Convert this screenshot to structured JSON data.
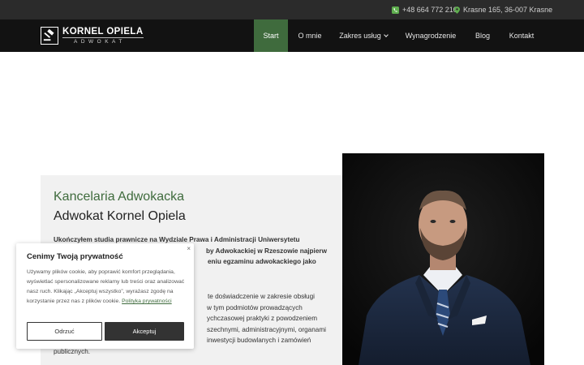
{
  "topbar": {
    "phone": "+48 664 772 210",
    "address": "Krasne 165, 36-007 Krasne"
  },
  "brand": {
    "name": "KORNEL OPIELA",
    "subtitle": "ADWOKAT"
  },
  "nav": [
    {
      "label": "Start",
      "active": true
    },
    {
      "label": "O mnie",
      "active": false
    },
    {
      "label": "Zakres usług",
      "active": false,
      "dropdown": true
    },
    {
      "label": "Wynagrodzenie",
      "active": false
    },
    {
      "label": "Blog",
      "active": false
    },
    {
      "label": "Kontakt",
      "active": false
    }
  ],
  "content": {
    "kicker": "Kancelaria Adwokacka",
    "heading": "Adwokat Kornel Opiela",
    "bold_lines": [
      "Ukończyłem studia prawnicze na Wydziale Prawa i Administracji Uniwersytetu",
      "by Adwokackiej w Rzeszowie najpierw",
      "eniu egzaminu adwokackiego jako"
    ],
    "lines": [
      "te doświadczenie w zakresie obsługi",
      "w tym podmiotów prowadzących",
      "ychczasowej praktyki z powodzeniem",
      "szechnymi, administracyjnymi, organami",
      "inwestycji budowlanych i zamówień",
      "publicznych."
    ]
  },
  "cookie": {
    "title": "Cenimy Twoją prywatność",
    "body": "Używamy plików cookie, aby poprawić komfort przeglądania, wyświetlać spersonalizowane reklamy lub treści oraz analizować nasz ruch. Klikając „Akceptuj wszystko”, wyrażasz zgodę na korzystanie przez nas z plików cookie.",
    "link": "Polityka prywatności",
    "close": "×",
    "reject": "Odrzuć",
    "accept": "Akceptuj"
  },
  "colors": {
    "accent": "#3f6b3d",
    "header_bg": "#121212",
    "topbar_bg": "#2b2b2b"
  }
}
